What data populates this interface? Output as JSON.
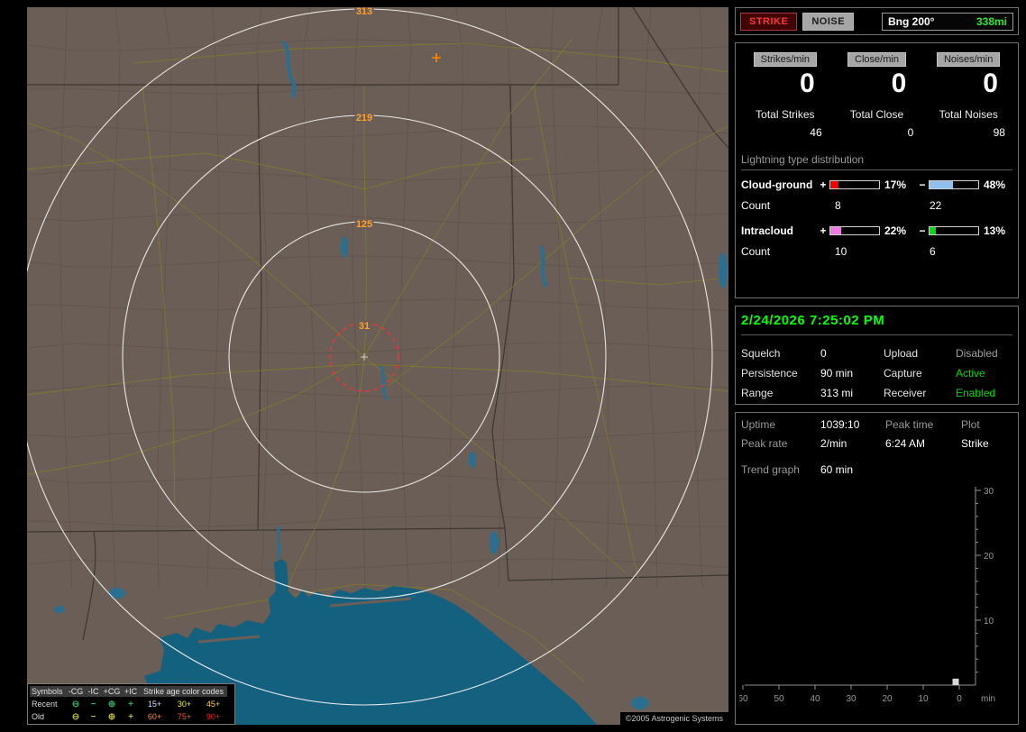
{
  "colors": {
    "datetime": "#00ff00",
    "active": "#00dd00",
    "disabled": "#a0a0a0",
    "bearing_distance": "#32e632",
    "cg_pos": "#f00000",
    "cg_neg": "#8fc0ee",
    "ic_pos": "#ee7ce0",
    "ic_neg": "#00d81c",
    "ring_labels": "#ffa030"
  },
  "map": {
    "rings": [
      {
        "label": "313"
      },
      {
        "label": "219"
      },
      {
        "label": "125"
      },
      {
        "label": "31"
      }
    ],
    "copyright": "©2005 Astrogenic Systems"
  },
  "legend": {
    "symbols_header": "Symbols",
    "columns": [
      "-CG",
      "-IC",
      "+CG",
      "+IC"
    ],
    "age_header": "Strike age color codes",
    "rows": [
      {
        "label": "Recent",
        "symbol_color": "#2fae60",
        "symbols": [
          "⊖",
          "−",
          "⊕",
          "+"
        ],
        "ages": [
          {
            "label": "15+",
            "color": "#cfe0ff"
          },
          {
            "label": "30+",
            "color": "#f0f040"
          },
          {
            "label": "45+",
            "color": "#ffc838"
          }
        ]
      },
      {
        "label": "Old",
        "symbol_color": "#b8b838",
        "symbols": [
          "⊖",
          "−",
          "⊕",
          "+"
        ],
        "ages": [
          {
            "label": "60+",
            "color": "#ff9028"
          },
          {
            "label": "75+",
            "color": "#ff5818"
          },
          {
            "label": "90+",
            "color": "#ff2010"
          }
        ]
      }
    ]
  },
  "toolbar": {
    "strike": "STRIKE",
    "noise": "NOISE",
    "bearing_label": "Bng 200°",
    "bearing_distance": "338mi"
  },
  "rates": [
    {
      "badge": "Strikes/min",
      "value": "0",
      "total_label": "Total Strikes",
      "total_value": "46"
    },
    {
      "badge": "Close/min",
      "value": "0",
      "total_label": "Total Close",
      "total_value": "0"
    },
    {
      "badge": "Noises/min",
      "value": "0",
      "total_label": "Total Noises",
      "total_value": "98"
    }
  ],
  "distribution": {
    "title": "Lightning type distribution",
    "rows": [
      {
        "label": "Cloud-ground",
        "plus": "+",
        "minus": "−",
        "pos_pct": 17,
        "pos_pct_label": "17%",
        "neg_pct": 48,
        "neg_pct_label": "48%",
        "count_label": "Count",
        "pos_count": "8",
        "neg_count": "22"
      },
      {
        "label": "Intracloud",
        "plus": "+",
        "minus": "−",
        "pos_pct": 22,
        "pos_pct_label": "22%",
        "neg_pct": 13,
        "neg_pct_label": "13%",
        "count_label": "Count",
        "pos_count": "10",
        "neg_count": "6"
      }
    ]
  },
  "status": {
    "datetime": "2/24/2026 7:25:02 PM",
    "rows": [
      {
        "l1": "Squelch",
        "v1": "0",
        "l2": "Upload",
        "v2": "Disabled",
        "v2_color": "#a0a0a0"
      },
      {
        "l1": "Persistence",
        "v1": "90 min",
        "l2": "Capture",
        "v2": "Active",
        "v2_color": "#00dd00"
      },
      {
        "l1": "Range",
        "v1": "313 mi",
        "l2": "Receiver",
        "v2": "Enabled",
        "v2_color": "#00dd00"
      }
    ]
  },
  "stats": {
    "uptime_label": "Uptime",
    "uptime": "1039:10",
    "peak_time_label": "Peak time",
    "plot_label": "Plot",
    "peak_rate_label": "Peak rate",
    "peak_rate": "2/min",
    "peak_time": "6:24 AM",
    "plot": "Strike",
    "trend_label": "Trend graph",
    "trend_window": "60 min"
  },
  "chart_data": {
    "type": "bar",
    "title": "Trend graph — strikes per minute over last 60 minutes",
    "xlabel": "min",
    "ylabel": "",
    "xunit": "min",
    "ylim": [
      0,
      30
    ],
    "yticks": [
      10,
      20,
      30
    ],
    "xticks": [
      60,
      50,
      40,
      30,
      20,
      10,
      0
    ],
    "bars": [
      {
        "minutes_ago": 1,
        "value": 1
      }
    ],
    "bar_color": "#d8d8d8",
    "legend_position": "none",
    "grid": false
  }
}
